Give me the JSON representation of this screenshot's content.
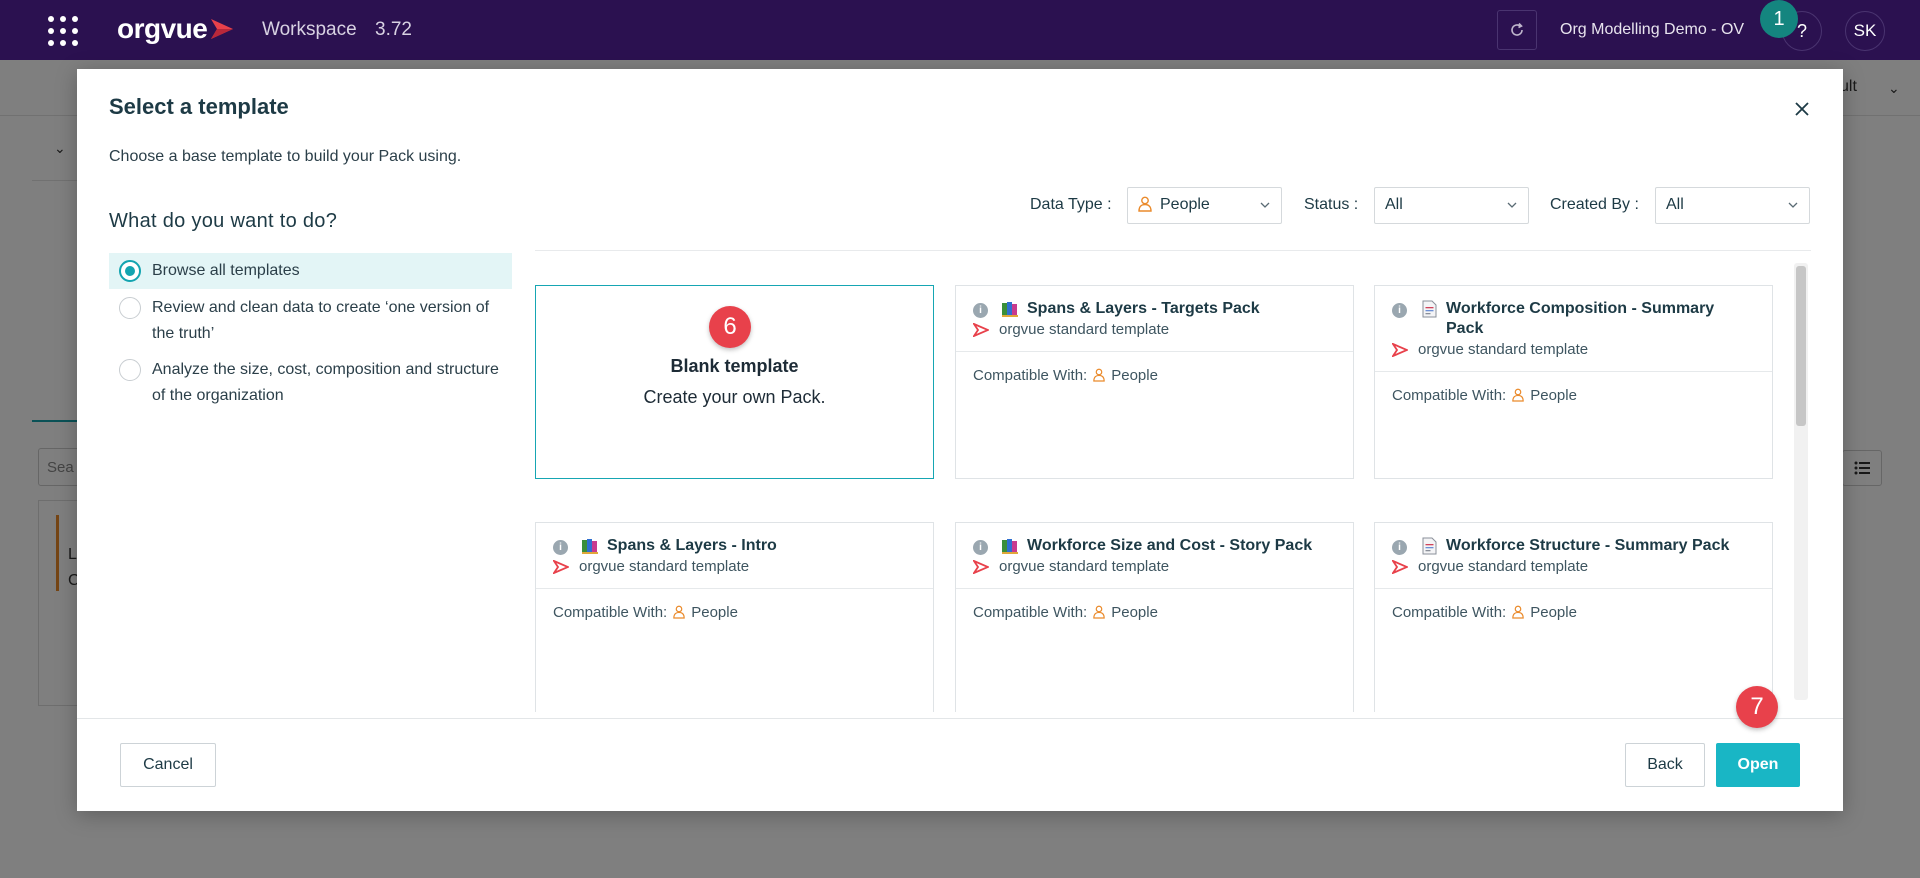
{
  "topbar": {
    "logo_text": "orgvue",
    "product": "Workspace",
    "version": "3.72",
    "workspace_name": "Org Modelling Demo - OV",
    "help": "?",
    "avatar": "SK",
    "notification_count": "1",
    "bg_color": "#2b1150"
  },
  "background": {
    "result_text": "ult",
    "search_placeholder": "Sea",
    "card_line1": "L",
    "card_line2": "C"
  },
  "modal": {
    "title": "Select a template",
    "subtitle": "Choose a base template to build your Pack using.",
    "question": "What do you want to do?",
    "options": [
      {
        "label": "Browse all templates",
        "selected": true
      },
      {
        "label": "Review and clean data to create ‘one version of the truth’",
        "selected": false
      },
      {
        "label": "Analyze the size, cost, composition and structure of the organization",
        "selected": false
      }
    ],
    "filters": {
      "data_type_label": "Data Type :",
      "data_type_value": "People",
      "status_label": "Status :",
      "status_value": "All",
      "created_by_label": "Created By :",
      "created_by_value": "All"
    },
    "blank_card": {
      "title": "Blank template",
      "subtitle": "Create your own Pack."
    },
    "compat_label": "Compatible With:",
    "templates": [
      {
        "title": "Spans & Layers - Targets Pack",
        "source": "orgvue standard template",
        "compatible": "People",
        "icon": "colored-book-icon"
      },
      {
        "title": "Workforce Composition - Summary Pack",
        "source": "orgvue standard template",
        "compatible": "People",
        "icon": "document-icon"
      },
      {
        "title": "Spans & Layers - Intro",
        "source": "orgvue standard template",
        "compatible": "People",
        "icon": "colored-book-icon"
      },
      {
        "title": "Workforce Size and Cost - Story Pack",
        "source": "orgvue standard template",
        "compatible": "People",
        "icon": "colored-book-icon"
      },
      {
        "title": "Workforce Structure - Summary Pack",
        "source": "orgvue standard template",
        "compatible": "People",
        "icon": "document-icon"
      }
    ],
    "buttons": {
      "cancel": "Cancel",
      "back": "Back",
      "open": "Open"
    },
    "step_badges": {
      "blank": "6",
      "open": "7"
    },
    "colors": {
      "accent": "#19b6c5",
      "selected_bg": "#e3f5f6",
      "badge": "#e8414b",
      "person_icon": "#ea8a2b"
    }
  }
}
